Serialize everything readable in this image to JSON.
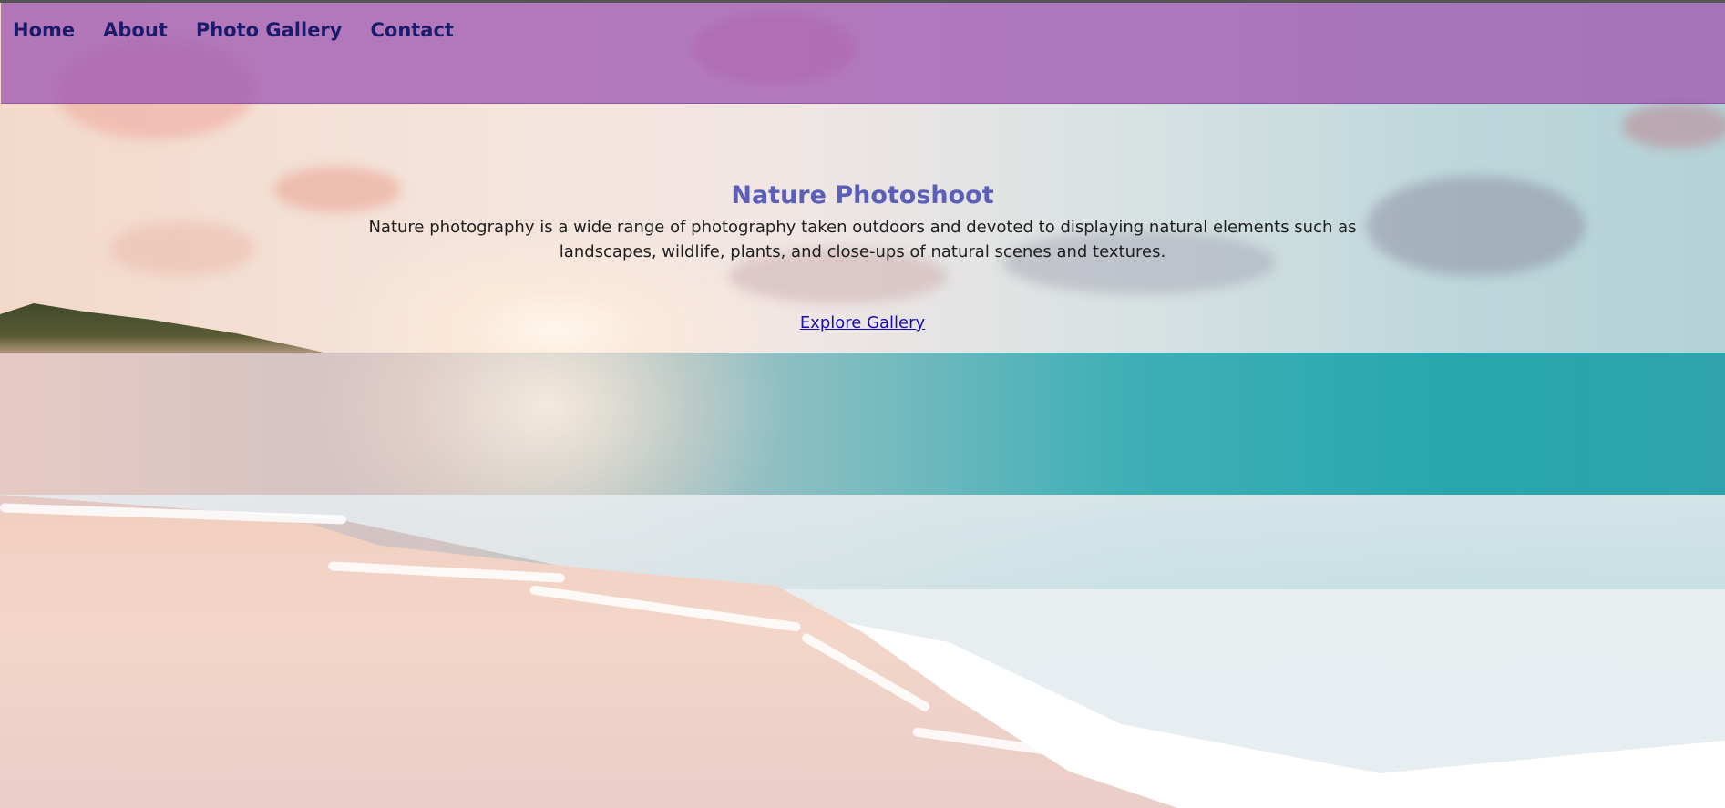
{
  "nav": {
    "items": [
      {
        "label": "Home"
      },
      {
        "label": "About"
      },
      {
        "label": "Photo Gallery"
      },
      {
        "label": "Contact"
      }
    ]
  },
  "hero": {
    "title": "Nature Photoshoot",
    "description": "Nature photography is a wide range of photography taken outdoors and devoted to displaying natural elements such as landscapes, wildlife, plants, and close-ups of natural scenes and textures.",
    "cta_label": "Explore Gallery"
  },
  "colors": {
    "navbar_bg": "#a05ab4",
    "nav_text": "#1b1b6b",
    "title": "#5b5fb7",
    "link": "#1a0dab"
  }
}
